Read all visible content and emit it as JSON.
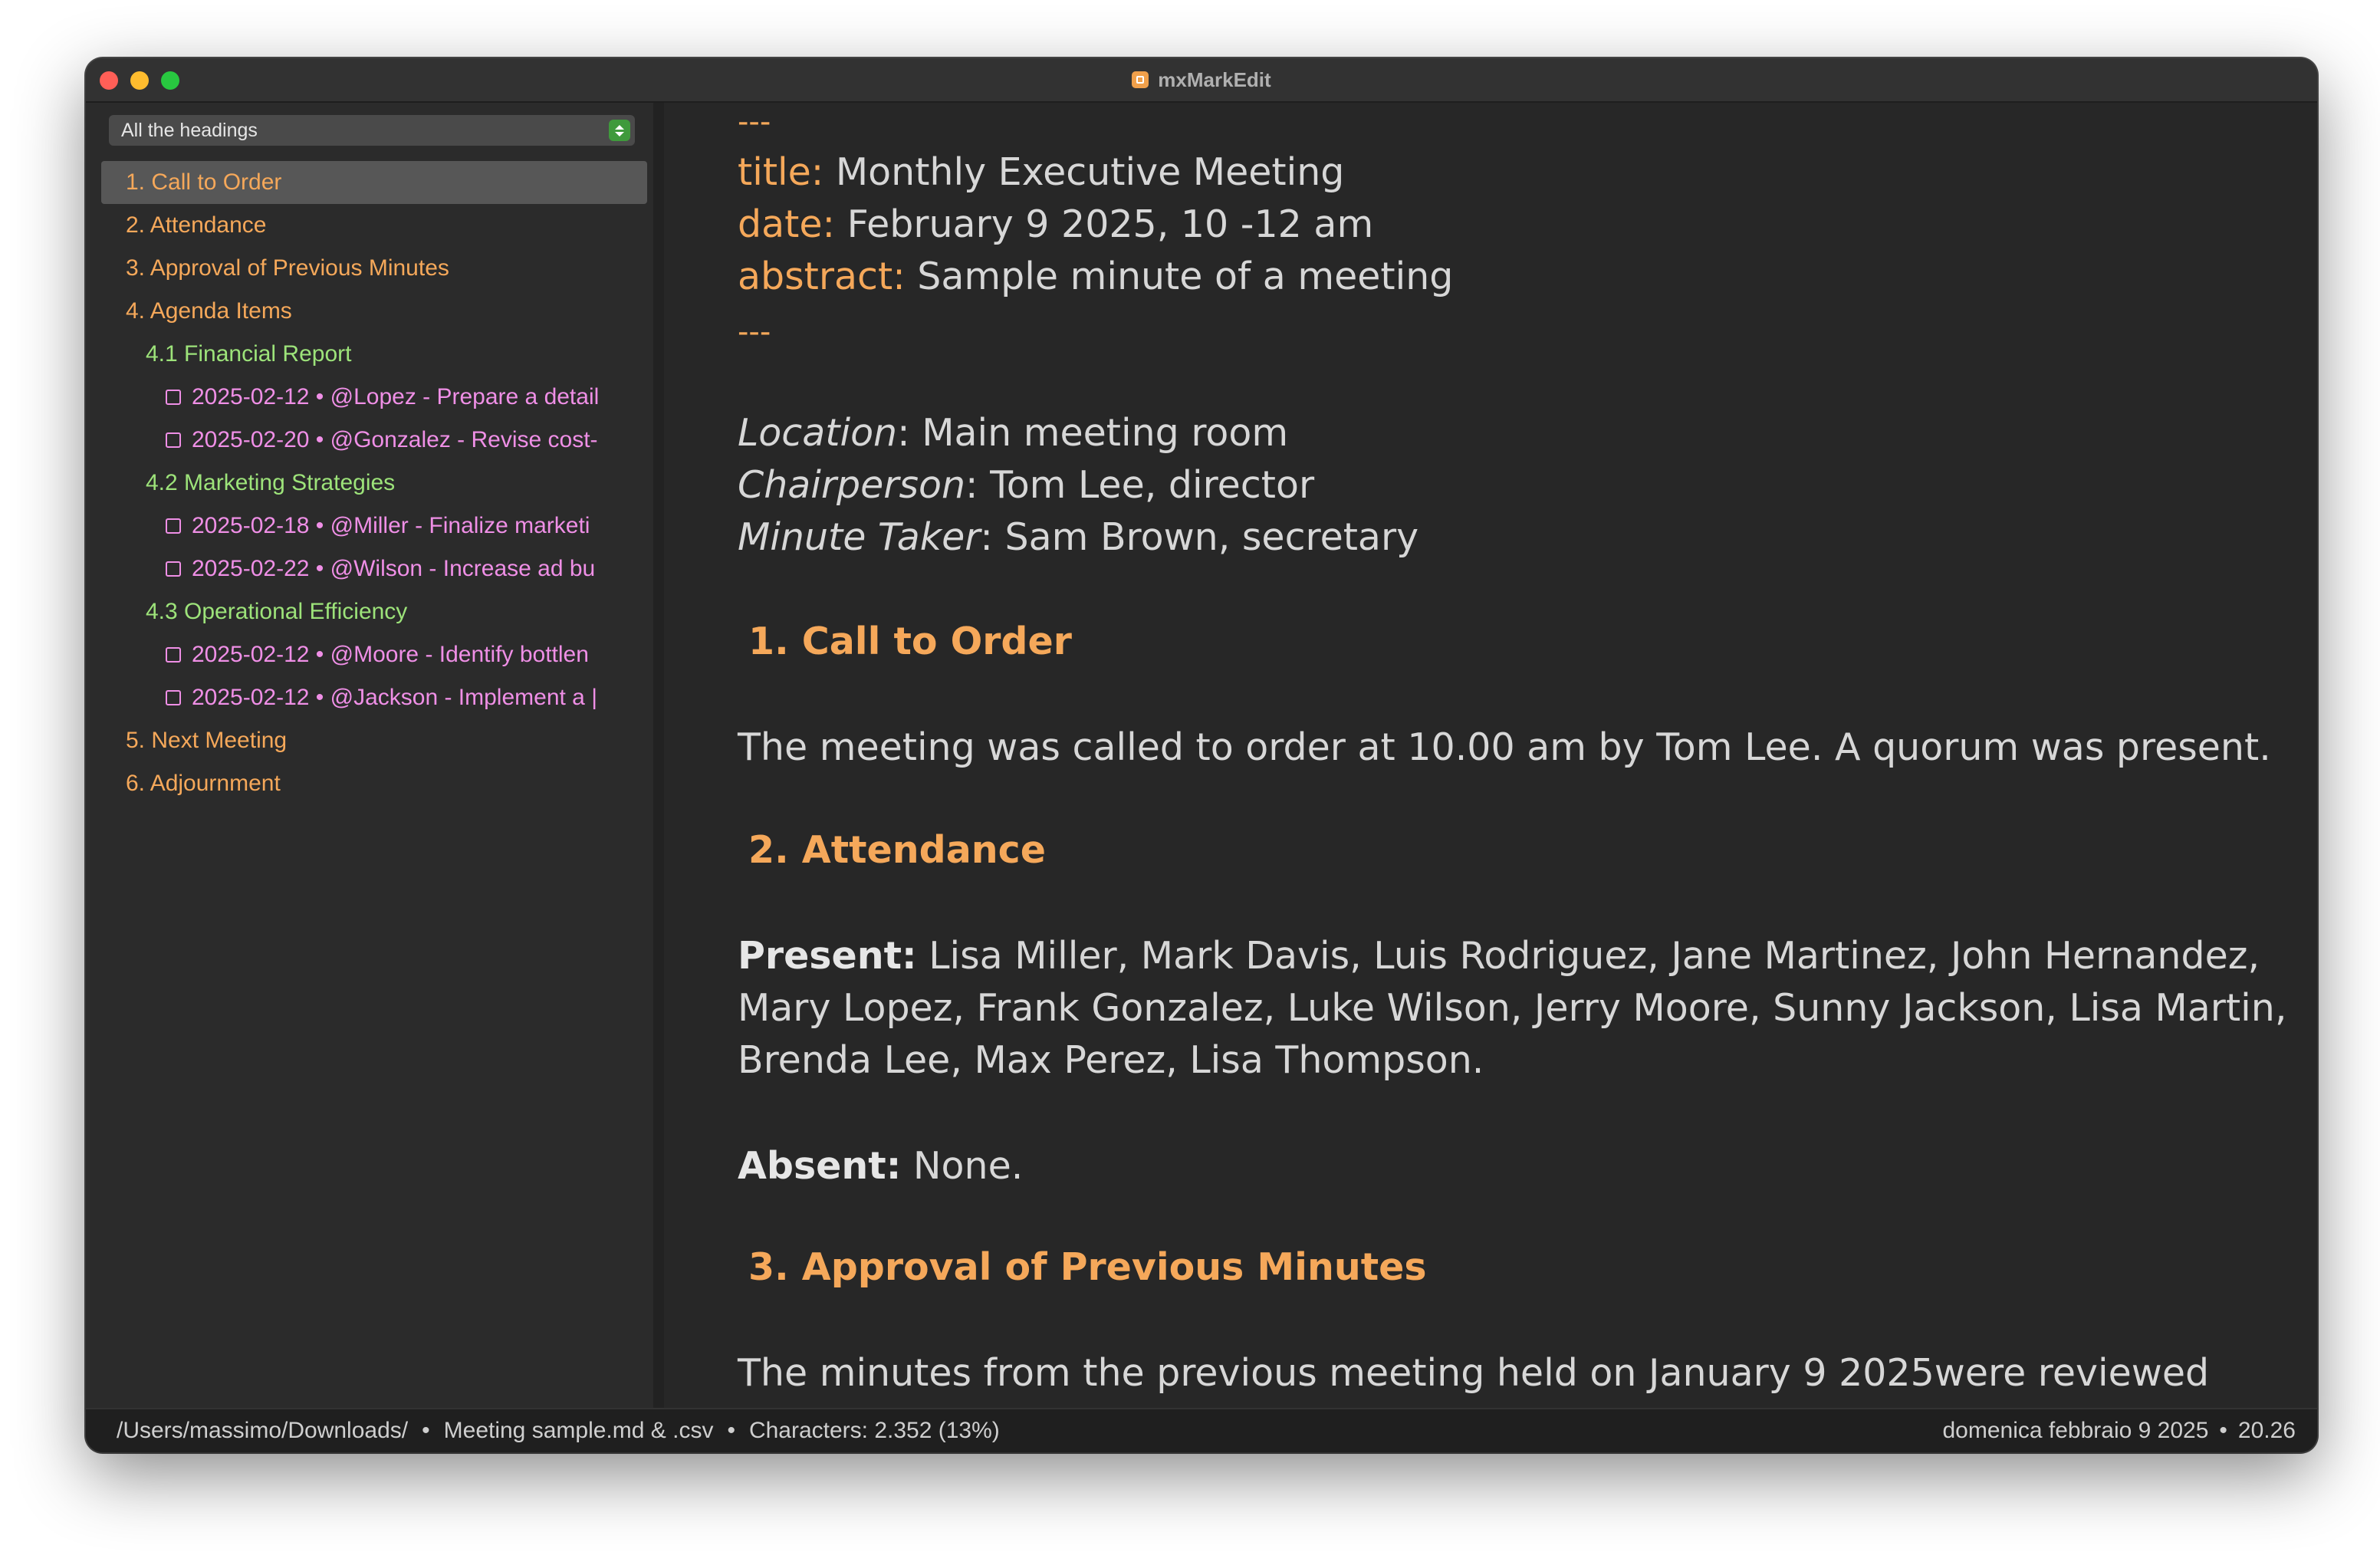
{
  "window": {
    "title": "mxMarkEdit"
  },
  "sidebar": {
    "dropdown_value": "All the headings",
    "items": [
      {
        "label": "1. Call to Order",
        "level": 1,
        "selected": true
      },
      {
        "label": "2. Attendance",
        "level": 1
      },
      {
        "label": "3. Approval of Previous Minutes",
        "level": 1
      },
      {
        "label": "4. Agenda Items",
        "level": 1
      },
      {
        "label": "4.1 Financial Report",
        "level": 2
      },
      {
        "label": "2025-02-12 • @Lopez - Prepare a detail",
        "level": 3,
        "checkbox": true
      },
      {
        "label": "2025-02-20 • @Gonzalez - Revise cost-",
        "level": 3,
        "checkbox": true
      },
      {
        "label": "4.2 Marketing Strategies",
        "level": 2
      },
      {
        "label": "2025-02-18 • @Miller - Finalize marketi",
        "level": 3,
        "checkbox": true
      },
      {
        "label": "2025-02-22 • @Wilson - Increase ad bu",
        "level": 3,
        "checkbox": true
      },
      {
        "label": "4.3 Operational Efficiency",
        "level": 2
      },
      {
        "label": "2025-02-12 • @Moore - Identify bottlen",
        "level": 3,
        "checkbox": true
      },
      {
        "label": "2025-02-12 • @Jackson - Implement a |",
        "level": 3,
        "checkbox": true
      },
      {
        "label": "5. Next Meeting",
        "level": 1
      },
      {
        "label": "6. Adjournment",
        "level": 1
      }
    ]
  },
  "editor": {
    "frontmatter_delim": "---",
    "frontmatter": [
      {
        "key": "title:",
        "value": " Monthly Executive Meeting"
      },
      {
        "key": "date:",
        "value": " February 9 2025, 10 -12 am"
      },
      {
        "key": "abstract:",
        "value": " Sample minute of a meeting"
      }
    ],
    "meta": [
      {
        "key": "Location",
        "value": ": Main meeting room"
      },
      {
        "key": "Chairperson",
        "value": ": Tom Lee, director"
      },
      {
        "key": "Minute Taker",
        "value": ": Sam Brown, secretary"
      }
    ],
    "heading1": "1. Call to Order",
    "para1": "The meeting was called to order at 10.00 am by Tom Lee. A quorum was present.",
    "heading2": "2. Attendance",
    "present_label": "Present:",
    "present_line1": "  Lisa Miller, Mark Davis, Luis Rodriguez, Jane Martinez, John Hernandez,",
    "present_line2": "Mary Lopez, Frank Gonzalez, Luke Wilson, Jerry Moore, Sunny Jackson, Lisa Martin,",
    "present_line3": "Brenda Lee, Max Perez, Lisa Thompson.",
    "absent_label": "Absent:",
    "absent_value": "  None.",
    "heading3": "3. Approval of Previous Minutes",
    "para3": "The minutes from the previous meeting held on January 9 2025were reviewed"
  },
  "statusbar": {
    "path": "/Users/massimo/Downloads/",
    "file": "Meeting sample.md & .csv",
    "characters": "Characters: 2.352 (13%)",
    "date": "domenica febbraio 9 2025",
    "time": "20.26",
    "separator": "•"
  },
  "colors": {
    "heading": "#f5a85a",
    "subheading": "#9de37a",
    "task": "#ef8fe6",
    "background": "#262626"
  }
}
